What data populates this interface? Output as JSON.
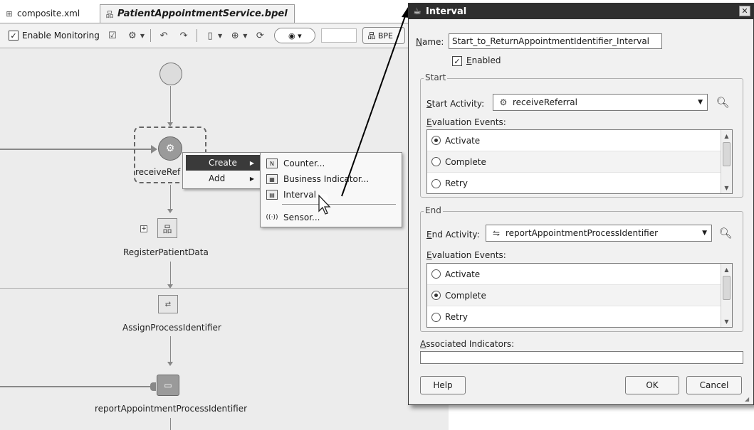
{
  "editor": {
    "tabs": [
      {
        "label": "composite.xml",
        "icon": "composite-icon"
      },
      {
        "label": "PatientAppointmentService.bpel",
        "icon": "bpel-icon"
      }
    ],
    "toolbar": {
      "enable_monitoring": {
        "label": "Enable Monitoring",
        "checked": true
      },
      "bpel_button": "BPE"
    },
    "activities": [
      {
        "name": "receiveReferral",
        "label": "receiveRef",
        "icon": "receive-icon"
      },
      {
        "name": "RegisterPatientData",
        "label": "RegisterPatientData",
        "icon": "scope-icon"
      },
      {
        "name": "AssignProcessIdentifier",
        "label": "AssignProcessIdentifier",
        "icon": "assign-icon"
      },
      {
        "name": "reportAppointmentProcessIdentifier",
        "label": "reportAppointmentProcessIdentifier",
        "icon": "invoke-icon"
      }
    ],
    "context_menu": {
      "items": [
        {
          "label": "Create",
          "selected": true
        },
        {
          "label": "Add",
          "selected": false
        }
      ],
      "submenu": [
        {
          "label": "Counter...",
          "icon_text": "N"
        },
        {
          "label": "Business Indicator...",
          "icon_text": "▦"
        },
        {
          "label": "Interval",
          "icon_text": "▤"
        },
        {
          "label": "Sensor...",
          "icon_text": "((·))"
        }
      ]
    }
  },
  "dialog": {
    "title": "Interval",
    "name_label": "Name:",
    "name_value": "Start_to_ReturnAppointmentIdentifier_Interval",
    "enabled_label": "Enabled",
    "enabled": true,
    "start": {
      "group_title": "Start",
      "activity_label": "Start Activity:",
      "activity_value": "receiveReferral",
      "events_label": "Evaluation Events:",
      "events": [
        {
          "label": "Activate",
          "selected": true
        },
        {
          "label": "Complete",
          "selected": false
        },
        {
          "label": "Retry",
          "selected": false
        }
      ]
    },
    "end": {
      "group_title": "End",
      "activity_label": "End Activity:",
      "activity_value": "reportAppointmentProcessIdentifier",
      "events_label": "Evaluation Events:",
      "events": [
        {
          "label": "Activate",
          "selected": false
        },
        {
          "label": "Complete",
          "selected": true
        },
        {
          "label": "Retry",
          "selected": false
        }
      ]
    },
    "associated_indicators_label": "Associated Indicators:",
    "associated_indicators_value": "",
    "buttons": {
      "help": "Help",
      "ok": "OK",
      "cancel": "Cancel"
    }
  }
}
